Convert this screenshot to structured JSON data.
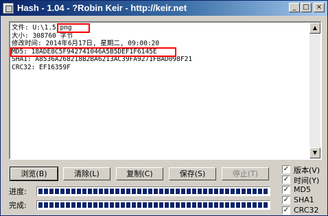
{
  "window": {
    "title": "Hash - 1.04 - ?Robin Keir - http://keir.net",
    "minimize_label": "_",
    "maximize_label": "□",
    "close_label": "×"
  },
  "output": {
    "lines": [
      "文件: U:\\1.5.png",
      "大小: 308760 字节",
      "修改时间: 2014年6月17日, 星期二, 09:00:20",
      "MD5: 18ADE8C5F942741046A5B5DEF1F6145E",
      "SHA1: A8536A268218B2BA6213AC39FA9271FBAD098F21",
      "CRC32: EF16359F"
    ]
  },
  "scrollbar": {
    "up_arrow": "▲",
    "down_arrow": "▼"
  },
  "buttons": {
    "browse": "浏览(B)",
    "clear": "清除(L)",
    "copy": "复制(C)",
    "save": "保存(S)",
    "stop": "停止(T)"
  },
  "progress": {
    "label": "进度:",
    "fraction": 1.0
  },
  "complete": {
    "label": "完成:",
    "fraction": 1.0
  },
  "options": [
    {
      "label": "版本(V)",
      "checked": true
    },
    {
      "label": "时间(Y)",
      "checked": true
    },
    {
      "label": "MD5",
      "checked": true
    },
    {
      "label": "SHA1",
      "checked": true
    },
    {
      "label": "CRC32",
      "checked": true
    }
  ],
  "check_mark": "✓"
}
